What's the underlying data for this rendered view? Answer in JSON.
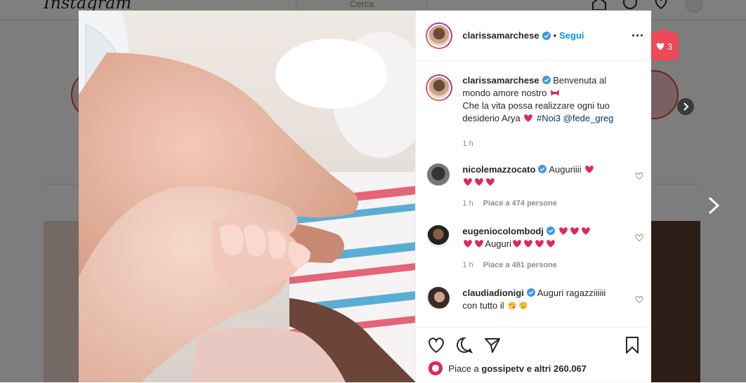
{
  "background": {
    "logo": "Instagram",
    "search_placeholder": "Cerca",
    "notification_count": "3"
  },
  "post": {
    "author": "clarissamarchese",
    "follow_label": "Segui",
    "dot": "•",
    "caption": {
      "line1": "Benvenuta al mondo amore nostro",
      "line2": "Che la vita possa realizzare ogni tuo desiderio Arya",
      "hashtag": "#Noi3",
      "mention": "@fede_greg",
      "time": "1 h"
    },
    "comments": [
      {
        "user": "nicolemazzocato",
        "text": "Auguriiii",
        "time": "1 h",
        "likes": "Piace a 474 persone"
      },
      {
        "user": "eugeniocolombodj",
        "text": "Auguri",
        "time": "1 h",
        "likes": "Piace a 481 persone"
      },
      {
        "user": "claudiadionigi",
        "text": "Auguri ragazziiiiii con tutto il",
        "time": "",
        "likes": ""
      }
    ],
    "likes_line": {
      "prefix": "Piace a",
      "user": "gossipetv",
      "suffix": "e altri 260.067"
    }
  },
  "colors": {
    "accent": "#0095f6",
    "verified": "#3897f0",
    "heart": "#e0245e",
    "notification": "#ed4956"
  },
  "icons": [
    "home-icon",
    "explore-icon",
    "heart-icon",
    "more-options-icon",
    "verified-icon",
    "like-icon",
    "comment-icon",
    "share-icon",
    "bookmark-icon",
    "chevron-right-icon"
  ]
}
